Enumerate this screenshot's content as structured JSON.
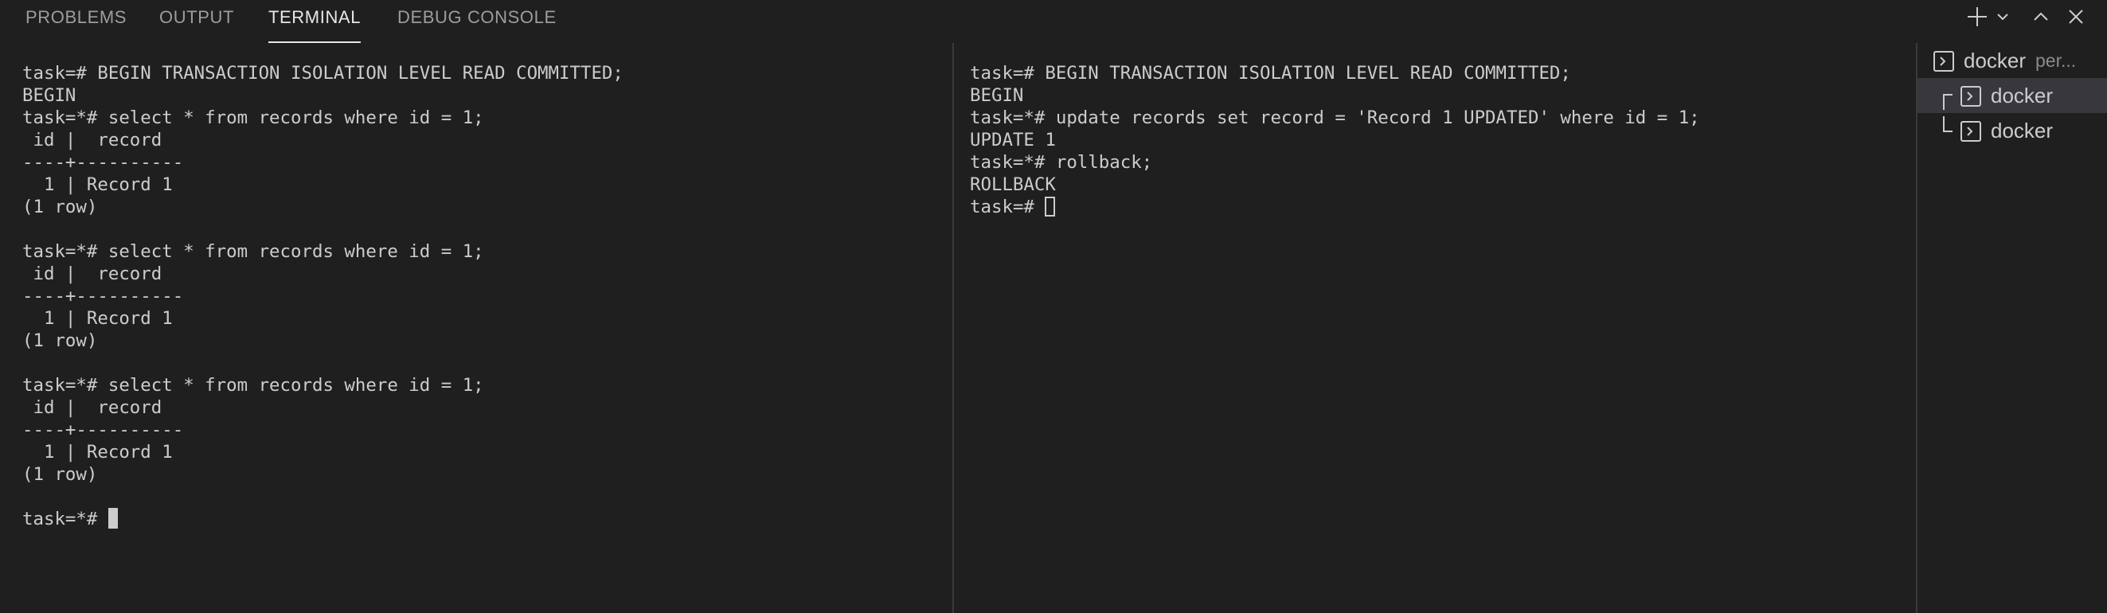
{
  "panel_tabs": [
    {
      "label": "PROBLEMS",
      "active": false
    },
    {
      "label": "OUTPUT",
      "active": false
    },
    {
      "label": "TERMINAL",
      "active": true
    },
    {
      "label": "DEBUG CONSOLE",
      "active": false
    }
  ],
  "actions": {
    "new_terminal_icon": "plus-icon",
    "launch_profile_icon": "chevron-down-icon",
    "maximize_icon": "chevron-up-icon",
    "close_icon": "close-icon"
  },
  "left_terminal": {
    "lines": [
      "task=# BEGIN TRANSACTION ISOLATION LEVEL READ COMMITTED;",
      "BEGIN",
      "task=*# select * from records where id = 1;",
      " id |  record",
      "----+----------",
      "  1 | Record 1",
      "(1 row)",
      "",
      "task=*# select * from records where id = 1;",
      " id |  record",
      "----+----------",
      "  1 | Record 1",
      "(1 row)",
      "",
      "task=*# select * from records where id = 1;",
      " id |  record",
      "----+----------",
      "  1 | Record 1",
      "(1 row)",
      "",
      "task=*# "
    ]
  },
  "right_terminal": {
    "lines": [
      "task=# BEGIN TRANSACTION ISOLATION LEVEL READ COMMITTED;",
      "BEGIN",
      "task=*# update records set record = 'Record 1 UPDATED' where id = 1;",
      "UPDATE 1",
      "task=*# rollback;",
      "ROLLBACK",
      "task=# "
    ]
  },
  "terminal_list": {
    "group": {
      "label": "docker",
      "sublabel": "per...",
      "icon": "terminal-icon"
    },
    "items": [
      {
        "label": "docker",
        "icon": "terminal-icon",
        "selected": true
      },
      {
        "label": "docker",
        "icon": "terminal-icon",
        "selected": false
      }
    ]
  },
  "colors": {
    "background": "#1f1f1f",
    "text": "#cccccc",
    "tab_active": "#e7e7e7",
    "tab_inactive": "#9d9d9d",
    "selected_item": "#37373d"
  }
}
